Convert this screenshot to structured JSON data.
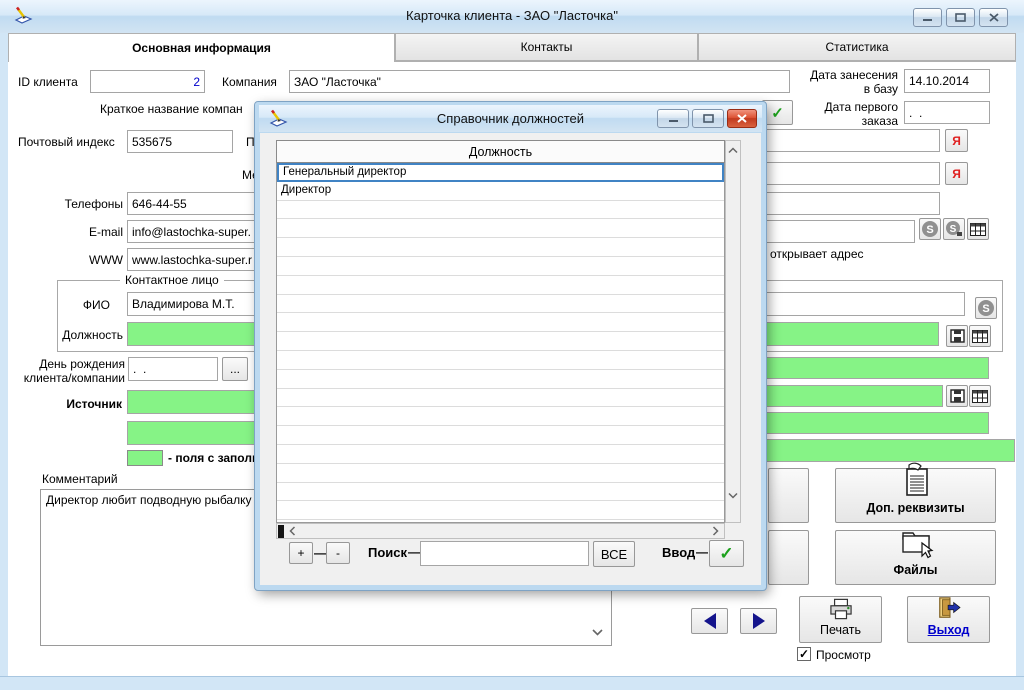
{
  "window": {
    "title": "Карточка клиента  -  ЗАО \"Ласточка\"",
    "tabs": [
      "Основная информация",
      "Контакты",
      "Статистика"
    ]
  },
  "form": {
    "id_label": "ID клиента",
    "id_value": "2",
    "company_label": "Компания",
    "company_value": "ЗАО \"Ласточка\"",
    "short_name_label": "Краткое название компан",
    "date_added_label": "Дата занесения\nв базу",
    "date_added_value": "14.10.2014",
    "first_order_label": "Дата первого\nзаказа",
    "first_order_value": ".  .",
    "postal_label": "Почтовый индекс",
    "postal_value": "535675",
    "label_fragment_p": "П",
    "label_fragment_me": "Ме",
    "ya_button": "Я",
    "phones_label": "Телефоны",
    "phones_value": "646-44-55",
    "email_label": "E-mail",
    "email_value": "info@lastochka-super.",
    "www_label": "WWW",
    "www_value": "www.lastochka-super.r",
    "opens_address_note": "открывает адрес",
    "contact_group_title": "Контактное лицо",
    "fio_label": "ФИО",
    "fio_value": "Владимирова М.Т.",
    "position_label": "Должность",
    "birthday_label": "День рождения\nклиента/компании",
    "birthday_value": ".  .",
    "ellipsis_button": "...",
    "source_label": "Источник",
    "legend_text": "- поля с заполн",
    "comment_label": "Комментарий",
    "comment_text": "Директор любит подводную рыбалку"
  },
  "actions": {
    "extra_requisites": "Доп. реквизиты",
    "files": "Файлы",
    "print": "Печать",
    "preview": "Просмотр",
    "preview_checked": true,
    "exit": "Выход"
  },
  "dialog": {
    "title": "Справочник должностей",
    "column_header": "Должность",
    "rows": [
      "Генеральный директор",
      "Директор"
    ],
    "selected_index": 0,
    "empty_row_count": 17,
    "add_button": "+",
    "remove_button": "-",
    "dash": "—",
    "search_label": "Поиск",
    "search_value": "",
    "all_button": "ВСЕ",
    "enter_label": "Ввод"
  },
  "icons": {
    "check": "✓"
  },
  "colors": {
    "field_green": "#86f386",
    "title_gradient_blue": "#c0dbf1",
    "link_blue": "#0000cc",
    "ya_red": "#e02020",
    "check_green": "#1da11d",
    "close_red": "#c23a1f",
    "selection_blue": "#4083c4"
  }
}
